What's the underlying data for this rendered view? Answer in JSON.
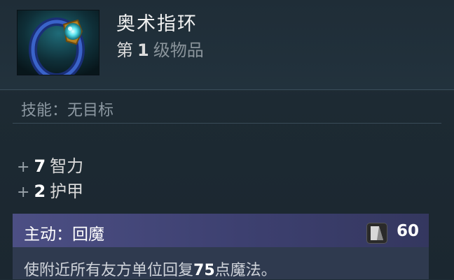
{
  "item": {
    "name": "奥术指环",
    "level_prefix": "第",
    "level_value": "1",
    "level_suffix": "级物品"
  },
  "ability": {
    "target_label": "技能：无目标"
  },
  "stats": [
    {
      "sign": "+",
      "value": "7",
      "name": "智力"
    },
    {
      "sign": "+",
      "value": "2",
      "name": "护甲"
    }
  ],
  "active": {
    "title": "主动：回魔",
    "cooldown_icon": "cooldown-icon",
    "cooldown_value": "60",
    "desc_pre": "使附近所有友方单位回复",
    "desc_value": "75",
    "desc_post": "点魔法。"
  },
  "colors": {
    "background": "#1e2b35",
    "active_bar": "#4c4f84",
    "accent_text": "#ffffff"
  }
}
